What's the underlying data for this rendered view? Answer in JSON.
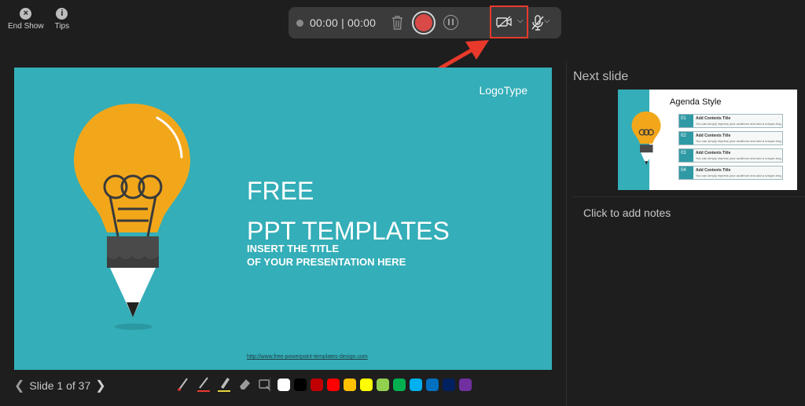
{
  "top_left": {
    "end_show_label": "End Show",
    "end_show_icon": "close-icon",
    "tips_label": "Tips",
    "tips_icon": "info-icon"
  },
  "recorder": {
    "elapsed": "00:00",
    "total": "00:00",
    "time_text": "00:00 | 00:00",
    "record_color": "#d94a47",
    "highlight_color": "#e8392b",
    "icons": [
      "recording-indicator-icon",
      "trash-icon",
      "record-icon",
      "pause-icon",
      "camera-off-icon",
      "chevron-down-icon",
      "mic-off-icon",
      "chevron-down-icon"
    ]
  },
  "slide": {
    "background_color": "#34aeb8",
    "logo_text": "LogoType",
    "title_line1": "FREE",
    "title_line2": "PPT TEMPLATES",
    "subtitle_line1": "INSERT THE TITLE",
    "subtitle_line2": "OF YOUR PRESENTATION HERE",
    "url": "http://www.free-powerpoint-templates-design.com"
  },
  "next_slide": {
    "label": "Next slide",
    "thumb_title": "Agenda Style",
    "items": [
      {
        "num": "01",
        "title": "Add Contents Title",
        "desc": "You can simply impress your audience and add a unique zing."
      },
      {
        "num": "02",
        "title": "Add Contents Title",
        "desc": "You can simply impress your audience and add a unique zing."
      },
      {
        "num": "03",
        "title": "Add Contents Title",
        "desc": "You can simply impress your audience and add a unique zing."
      },
      {
        "num": "04",
        "title": "Add Contents Title",
        "desc": "You can simply impress your audience and add a unique zing."
      }
    ]
  },
  "notes": {
    "placeholder": "Click to add notes"
  },
  "nav": {
    "slide_text": "Slide 1 of 37",
    "current": 1,
    "total": 37
  },
  "pen_tools": [
    "laser-pointer-icon",
    "pen-icon",
    "highlighter-icon",
    "eraser-icon",
    "clear-ink-icon"
  ],
  "ink_colors": [
    "#ffffff",
    "#000000",
    "#c00000",
    "#ff0000",
    "#ffc000",
    "#ffff00",
    "#92d050",
    "#00b050",
    "#00b0f0",
    "#0070c0",
    "#002060",
    "#7030a0"
  ]
}
